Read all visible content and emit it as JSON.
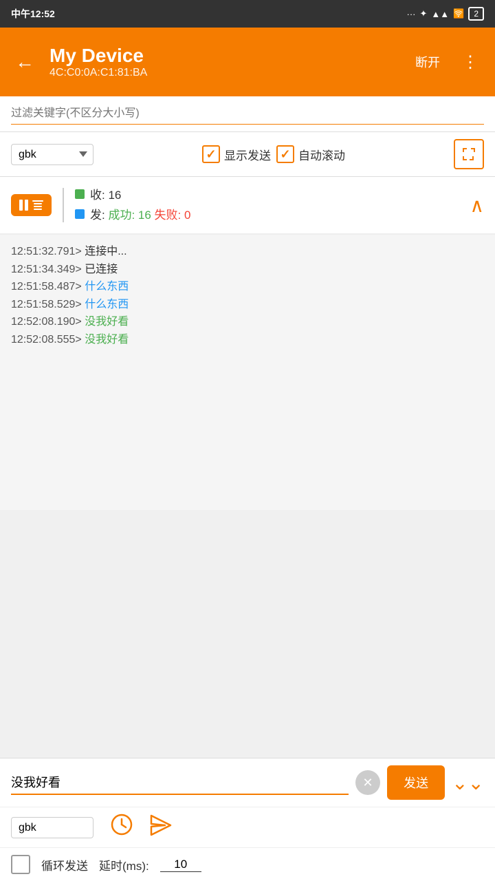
{
  "statusBar": {
    "time": "中午12:52",
    "icons": "... ✦ ▲ ▲ ▼ 2"
  },
  "header": {
    "title": "My Device",
    "subtitle": "4C:C0:0A:C1:81:BA",
    "disconnectLabel": "断开",
    "backIcon": "←",
    "moreIcon": "⋮"
  },
  "filterBar": {
    "placeholder": "过滤关键字(不区分大小写)"
  },
  "toolbar": {
    "encoding": "gbk",
    "showSendLabel": "显示发送",
    "autoScrollLabel": "自动滚动"
  },
  "stats": {
    "recvLabel": "收: 16",
    "sendLabel": "发: 成功: 16 失败: 0"
  },
  "logs": [
    {
      "time": "12:51:32.791>",
      "msg": "连接中...",
      "color": "normal"
    },
    {
      "time": "12:51:34.349>",
      "msg": "已连接",
      "color": "normal"
    },
    {
      "time": "12:51:58.487>",
      "msg": "什么东西",
      "color": "blue"
    },
    {
      "time": "12:51:58.529>",
      "msg": "什么东西",
      "color": "blue"
    },
    {
      "time": "12:52:08.190>",
      "msg": "没我好看",
      "color": "green"
    },
    {
      "time": "12:52:08.555>",
      "msg": "没我好看",
      "color": "green"
    }
  ],
  "bottomInput": {
    "value": "没我好看",
    "sendLabel": "发送",
    "encoding": "gbk"
  },
  "loopRow": {
    "label": "循环发送",
    "delayLabel": "延时(ms):",
    "delayValue": "10"
  }
}
